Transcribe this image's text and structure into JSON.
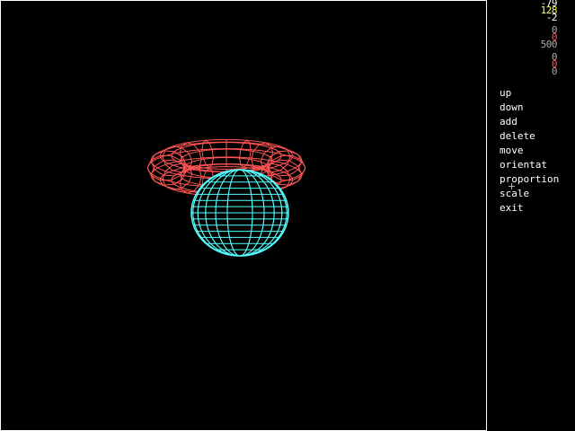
{
  "colors": {
    "background": "#000000",
    "frame": "#ffffff",
    "torus": "#ff5555",
    "sphere": "#55ffff",
    "text": "#ffffff",
    "readout_yellow": "#ffff55",
    "readout_grey": "#aaaaaa",
    "readout_red": "#ff5555"
  },
  "scene": {
    "objects": [
      {
        "name": "torus",
        "shape": "torus-wireframe",
        "color": "#ff5555"
      },
      {
        "name": "sphere",
        "shape": "sphere-wireframe",
        "color": "#55ffff"
      }
    ]
  },
  "readouts": {
    "r1": "-79",
    "r2": "128",
    "r3": "-2",
    "r4": "0",
    "r5": "0",
    "r6": "500",
    "r7": "0",
    "r8": "0",
    "r9": "0"
  },
  "menu": {
    "up": "up",
    "down": "down",
    "add": "add",
    "delete": "delete",
    "move": "move",
    "orientat": "orientat",
    "proportion": "proportion",
    "scale": "scale",
    "exit": "exit"
  }
}
